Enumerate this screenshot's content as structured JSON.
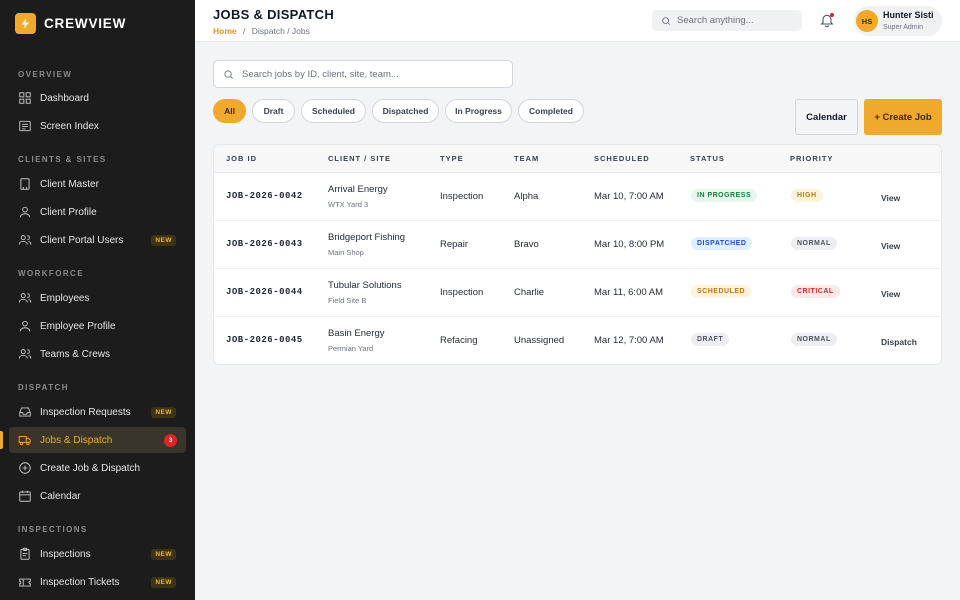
{
  "brand": {
    "name": "CREWVIEW",
    "icon": "lightning-icon",
    "accent": "#f0a92c"
  },
  "sidebar": {
    "sections": [
      {
        "title": "OVERVIEW",
        "items": [
          {
            "label": "Dashboard",
            "icon": "dashboard-grid-icon"
          },
          {
            "label": "Screen Index",
            "icon": "screen-index-icon"
          }
        ]
      },
      {
        "title": "CLIENTS & SITES",
        "items": [
          {
            "label": "Client Master",
            "icon": "building-icon"
          },
          {
            "label": "Client Profile",
            "icon": "user-icon"
          },
          {
            "label": "Client Portal Users",
            "icon": "users-icon",
            "badge": "NEW"
          }
        ]
      },
      {
        "title": "WORKFORCE",
        "items": [
          {
            "label": "Employees",
            "icon": "users-icon"
          },
          {
            "label": "Employee Profile",
            "icon": "user-icon"
          },
          {
            "label": "Teams & Crews",
            "icon": "users-icon"
          }
        ]
      },
      {
        "title": "DISPATCH",
        "items": [
          {
            "label": "Inspection Requests",
            "icon": "inbox-icon",
            "badge": "NEW"
          },
          {
            "label": "Jobs & Dispatch",
            "icon": "truck-icon",
            "count": "3",
            "active": true
          },
          {
            "label": "Create Job & Dispatch",
            "icon": "plus-circle-icon"
          },
          {
            "label": "Calendar",
            "icon": "calendar-icon"
          }
        ]
      },
      {
        "title": "INSPECTIONS",
        "items": [
          {
            "label": "Inspections",
            "icon": "clipboard-icon",
            "badge": "NEW"
          },
          {
            "label": "Inspection Tickets",
            "icon": "ticket-icon",
            "badge": "NEW"
          }
        ]
      }
    ]
  },
  "header": {
    "title": "JOBS & DISPATCH",
    "breadcrumb": {
      "home": "Home",
      "separator": "/",
      "path": "Dispatch / Jobs"
    },
    "search_placeholder": "Search anything...",
    "notification_icon": "bell-icon",
    "user": {
      "initials": "HS",
      "name": "Hunter Sisti",
      "role": "Super Admin"
    }
  },
  "main": {
    "search_placeholder": "Search jobs by ID, client, site, team...",
    "filters": [
      "All",
      "Draft",
      "Scheduled",
      "Dispatched",
      "In Progress",
      "Completed"
    ],
    "active_filter": "All",
    "calendar_label": "Calendar",
    "create_label": "+ Create Job",
    "table": {
      "columns": [
        "JOB ID",
        "CLIENT / SITE",
        "TYPE",
        "TEAM",
        "SCHEDULED",
        "STATUS",
        "PRIORITY"
      ],
      "rows": [
        {
          "job_id": "JOB-2026-0042",
          "client": "Arrival Energy",
          "site": "WTX Yard 3",
          "type": "Inspection",
          "team": "Alpha",
          "scheduled": "Mar 10, 7:00 AM",
          "status": "IN PROGRESS",
          "status_key": "inprogress",
          "priority": "HIGH",
          "priority_key": "high",
          "action": "View"
        },
        {
          "job_id": "JOB-2026-0043",
          "client": "Bridgeport Fishing",
          "site": "Main Shop",
          "type": "Repair",
          "team": "Bravo",
          "scheduled": "Mar 10, 8:00 PM",
          "status": "DISPATCHED",
          "status_key": "dispatched",
          "priority": "NORMAL",
          "priority_key": "normal",
          "action": "View"
        },
        {
          "job_id": "JOB-2026-0044",
          "client": "Tubular Solutions",
          "site": "Field Site B",
          "type": "Inspection",
          "team": "Charlie",
          "scheduled": "Mar 11, 6:00 AM",
          "status": "SCHEDULED",
          "status_key": "scheduled",
          "priority": "CRITICAL",
          "priority_key": "critical",
          "action": "View"
        },
        {
          "job_id": "JOB-2026-0045",
          "client": "Basin Energy",
          "site": "Permian Yard",
          "type": "Refacing",
          "team": "Unassigned",
          "scheduled": "Mar 12, 7:00 AM",
          "status": "DRAFT",
          "status_key": "draft",
          "priority": "NORMAL",
          "priority_key": "normal",
          "action": "Dispatch"
        }
      ]
    }
  }
}
